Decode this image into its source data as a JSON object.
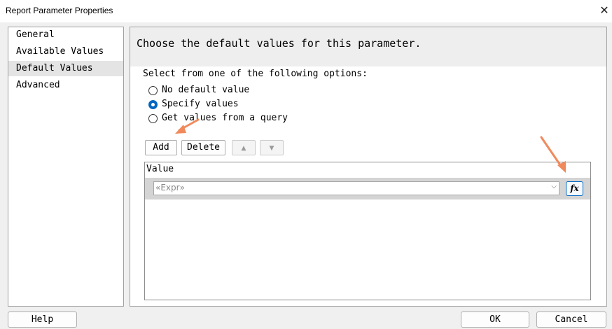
{
  "window": {
    "title": "Report Parameter Properties",
    "close_glyph": "✕"
  },
  "sidebar": {
    "items": [
      {
        "label": "General"
      },
      {
        "label": "Available Values"
      },
      {
        "label": "Default Values"
      },
      {
        "label": "Advanced"
      }
    ],
    "selected": "Default Values"
  },
  "main": {
    "heading": "Choose the default values for this parameter.",
    "prompt": "Select from one of the following options:",
    "options": [
      {
        "label": "No default value",
        "checked": false
      },
      {
        "label": "Specify values",
        "checked": true
      },
      {
        "label": "Get values from a query",
        "checked": false
      }
    ],
    "toolbar": {
      "add_label": "Add",
      "delete_label": "Delete",
      "move_up_glyph": "▲",
      "move_down_glyph": "▼"
    },
    "grid": {
      "header": "Value",
      "rows": [
        {
          "value": "«Expr»"
        }
      ],
      "fx_label": "fx",
      "dropdown_glyph": "⌵"
    }
  },
  "footer": {
    "help_label": "Help",
    "ok_label": "OK",
    "cancel_label": "Cancel"
  },
  "colors": {
    "accent": "#0067c0",
    "annotation_arrow": "#f08a5d",
    "selected_row": "#e4e4e4"
  },
  "icons": [
    "close-icon",
    "radio-icon",
    "arrow-up-icon",
    "arrow-down-icon",
    "chevron-down-icon",
    "function-icon",
    "annotation-arrow"
  ]
}
